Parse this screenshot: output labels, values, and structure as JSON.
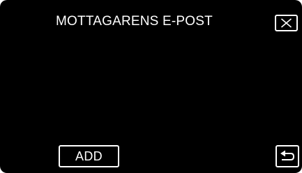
{
  "header": {
    "title": "MOTTAGARENS E-POST",
    "close_icon": "close-icon"
  },
  "footer": {
    "add_label": "ADD",
    "back_icon": "return-arrow-icon"
  },
  "colors": {
    "background": "#000000",
    "foreground": "#ffffff"
  }
}
